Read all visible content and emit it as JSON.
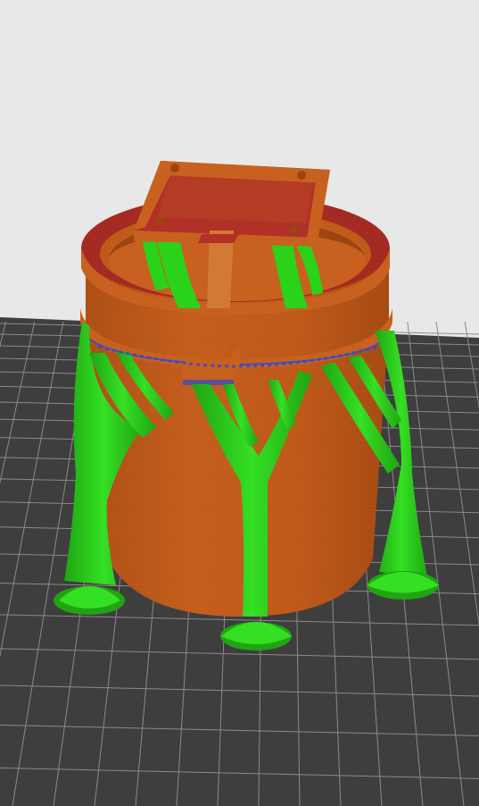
{
  "viewport": {
    "background_color": "#e8e8e8",
    "bed_color": "#3e3e3e",
    "grid_line_color": "#8a8a8a"
  },
  "model": {
    "body_color": "#c05a1a",
    "body_shadow_color": "#9c4512",
    "top_surface_color": "#b13027",
    "support_color": "#2ad21a",
    "support_shadow_color": "#1fa512"
  }
}
